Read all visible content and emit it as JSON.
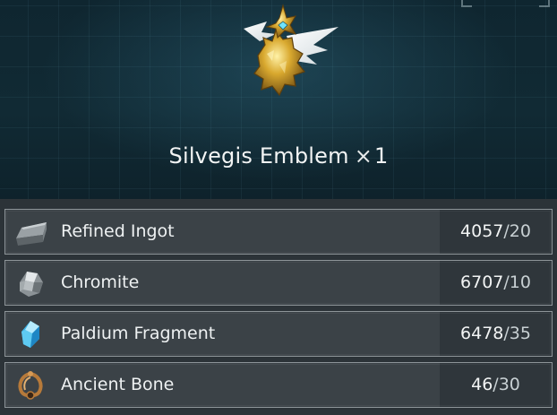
{
  "item": {
    "name": "Silvegis Emblem",
    "multiplier_symbol": "×",
    "quantity": "1",
    "icon": "golden-emblem-icon"
  },
  "materials": [
    {
      "name": "Refined Ingot",
      "owned": "4057",
      "separator": "/",
      "required": "20",
      "icon": "ingot-icon"
    },
    {
      "name": "Chromite",
      "owned": "6707",
      "separator": "/",
      "required": "10",
      "icon": "chromite-ore-icon"
    },
    {
      "name": "Paldium Fragment",
      "owned": "6478",
      "separator": "/",
      "required": "35",
      "icon": "paldium-crystal-icon"
    },
    {
      "name": "Ancient Bone",
      "owned": "46",
      "separator": "/",
      "required": "30",
      "icon": "ancient-bone-icon"
    }
  ],
  "colors": {
    "header_bg": "#0f2630",
    "panel_bg": "#2c3338",
    "row_bg": "#3b4247",
    "row_border": "#8e9599",
    "count_bg": "#2f363b",
    "text": "#f2f4f4"
  }
}
